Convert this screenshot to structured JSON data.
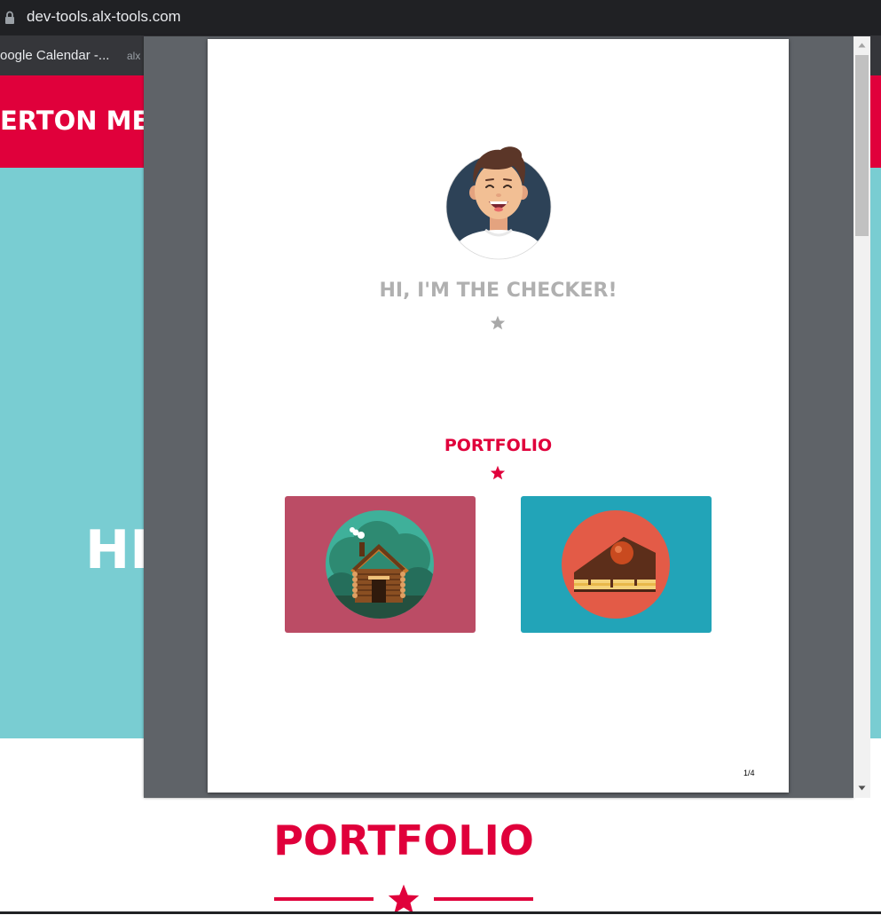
{
  "browser": {
    "url": "dev-tools.alx-tools.com",
    "bookmarks": [
      {
        "label": "oogle Calendar -..."
      },
      {
        "label": "alx"
      }
    ]
  },
  "background_page": {
    "header_title": "ERTON ME",
    "hero_title": "HI",
    "portfolio_title": "PORTFOLIO",
    "accent_color": "#e0003b",
    "hero_color": "#79cdd2"
  },
  "pdf_viewer": {
    "page": {
      "checker_title": "HI, I'M THE CHECKER!",
      "portfolio_title": "PORTFOLIO",
      "page_number": "1/4",
      "cards": [
        {
          "icon": "log-cabin-icon",
          "color": "#bb4c65"
        },
        {
          "icon": "cake-slice-icon",
          "color": "#22a4b8"
        }
      ]
    }
  }
}
